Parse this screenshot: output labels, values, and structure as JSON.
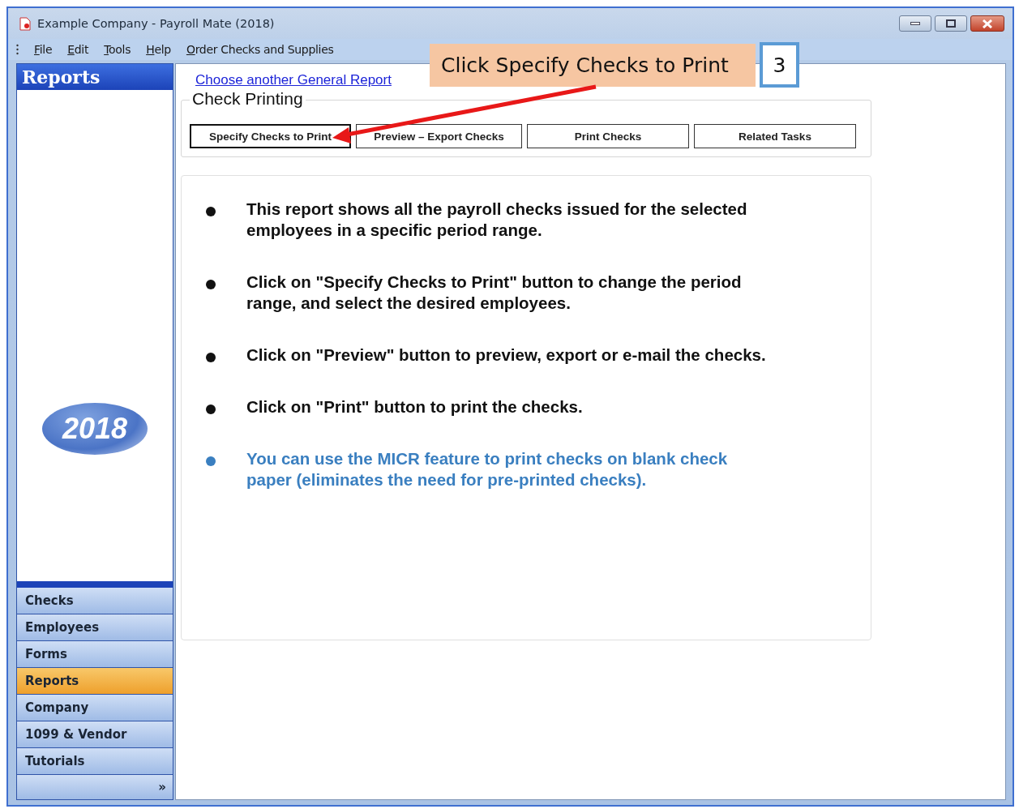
{
  "window": {
    "title": "Example Company - Payroll Mate (2018)"
  },
  "menu": [
    "File",
    "Edit",
    "Tools",
    "Help",
    "Order Checks and Supplies"
  ],
  "callout": {
    "label": "Click Specify Checks to Print",
    "step": "3"
  },
  "sidebar": {
    "header": "Reports",
    "year": "2018",
    "items": [
      {
        "label": "Checks",
        "selected": false
      },
      {
        "label": "Employees",
        "selected": false
      },
      {
        "label": "Forms",
        "selected": false
      },
      {
        "label": "Reports",
        "selected": true
      },
      {
        "label": "Company",
        "selected": false
      },
      {
        "label": "1099 & Vendor",
        "selected": false
      },
      {
        "label": "Tutorials",
        "selected": false
      }
    ],
    "more": "»"
  },
  "content": {
    "link": "Choose another General Report",
    "group_title": "Check Printing",
    "buttons": [
      {
        "label": "Specify Checks to Print",
        "selected": true
      },
      {
        "label": "Preview – Export Checks",
        "selected": false
      },
      {
        "label": "Print Checks",
        "selected": false
      },
      {
        "label": "Related Tasks",
        "selected": false
      }
    ],
    "notes": [
      {
        "kind": "info",
        "text": "This report shows all the payroll checks issued for the selected employees in a specific period range."
      },
      {
        "kind": "info",
        "text": "Click on \"Specify Checks to Print\" button to change the period range, and select the desired employees."
      },
      {
        "kind": "info",
        "text": "Click on \"Preview\" button to preview, export or e-mail the checks."
      },
      {
        "kind": "info",
        "text": "Click on \"Print\" button to print the checks."
      },
      {
        "kind": "tip",
        "text": "You can use the MICR feature to print checks on blank check paper (eliminates the need for pre-printed checks)."
      }
    ]
  }
}
